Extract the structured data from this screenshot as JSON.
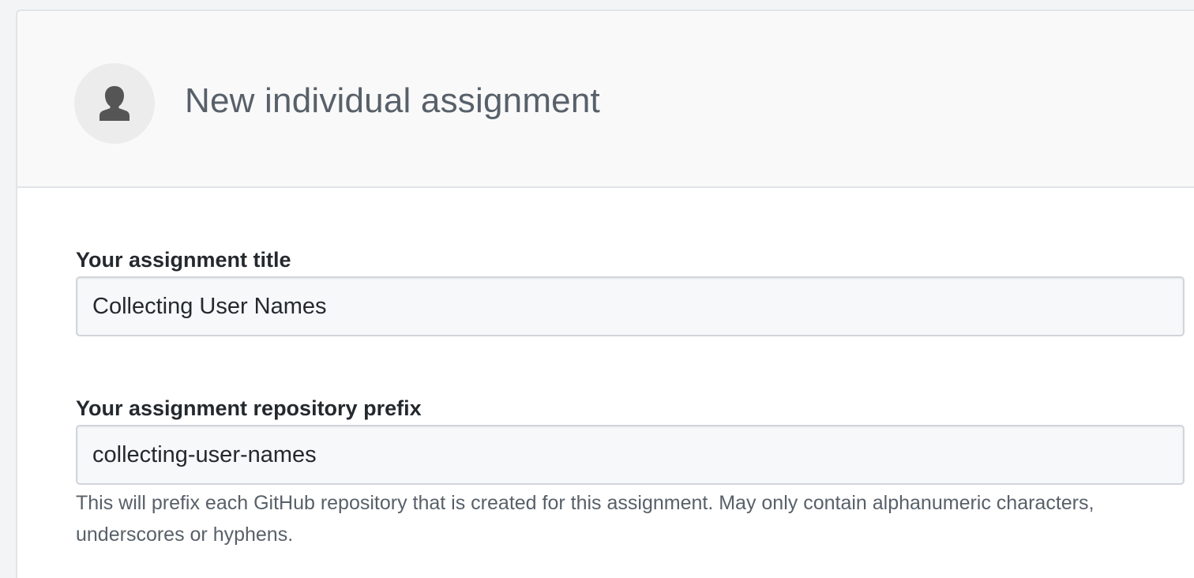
{
  "header": {
    "title": "New individual assignment",
    "icon": "person-icon"
  },
  "form": {
    "title_field": {
      "label": "Your assignment title",
      "value": "Collecting User Names"
    },
    "prefix_field": {
      "label": "Your assignment repository prefix",
      "value": "collecting-user-names",
      "note": "This will prefix each GitHub repository that is created for this assignment. May only contain alphanumeric characters, underscores or hyphens."
    }
  },
  "colors": {
    "header_bg": "#f9f9f9",
    "avatar_bg": "#ececec",
    "icon": "#555555",
    "title_text": "#586069",
    "input_bg": "#f6f8fa",
    "input_border": "#d1d5da"
  }
}
